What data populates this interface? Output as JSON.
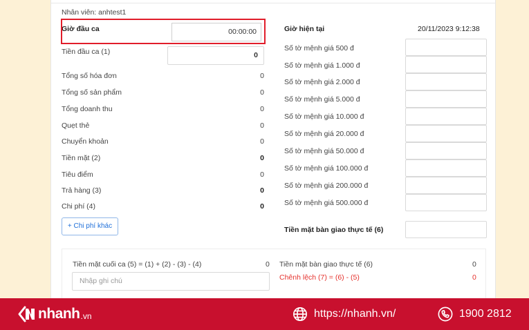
{
  "employee": "Nhân viên: anhtest1",
  "left": {
    "start_time_label": "Giờ đầu ca",
    "start_time_value": "00:00:00",
    "start_cash_label": "Tiền đầu ca (1)",
    "start_cash_value": "0",
    "rows": [
      {
        "label": "Tổng số hóa đơn",
        "value": "0"
      },
      {
        "label": "Tổng số sản phẩm",
        "value": "0"
      },
      {
        "label": "Tổng doanh thu",
        "value": "0"
      },
      {
        "label": "Quẹt thẻ",
        "value": "0"
      },
      {
        "label": "Chuyển khoản",
        "value": "0"
      },
      {
        "label": "Tiền mặt (2)",
        "value": "0"
      },
      {
        "label": "Tiêu điểm",
        "value": "0"
      },
      {
        "label": "Trả hàng (3)",
        "value": "0"
      },
      {
        "label": "Chi phí (4)",
        "value": "0"
      }
    ],
    "add_expense_button": "+ Chi phí khác"
  },
  "right": {
    "current_time_label": "Giờ hiện tại",
    "current_time_value": "20/11/2023 9:12:38",
    "denominations": [
      "Số tờ mệnh giá 500 đ",
      "Số tờ mệnh giá 1.000 đ",
      "Số tờ mệnh giá 2.000 đ",
      "Số tờ mệnh giá 5.000 đ",
      "Số tờ mệnh giá 10.000 đ",
      "Số tờ mệnh giá 20.000 đ",
      "Số tờ mệnh giá 50.000 đ",
      "Số tờ mệnh giá 100.000 đ",
      "Số tờ mệnh giá 200.000 đ",
      "Số tờ mệnh giá 500.000 đ"
    ],
    "handover_label": "Tiền mặt bàn giao thực tế (6)"
  },
  "summary": {
    "end_cash_label": "Tiền mặt cuối ca (5) = (1) + (2) - (3) - (4)",
    "end_cash_value": "0",
    "note_placeholder": "Nhập ghi chú",
    "handover_label": "Tiền mặt bàn giao thực tế (6)",
    "handover_value": "0",
    "diff_label": "Chênh lệch (7) = (6) - (5)",
    "diff_value": "0"
  },
  "footer": {
    "brand": "nhanh",
    "brand_suffix": ".vn",
    "website": "https://nhanh.vn/",
    "phone": "1900 2812",
    "background": "#c8102e"
  }
}
